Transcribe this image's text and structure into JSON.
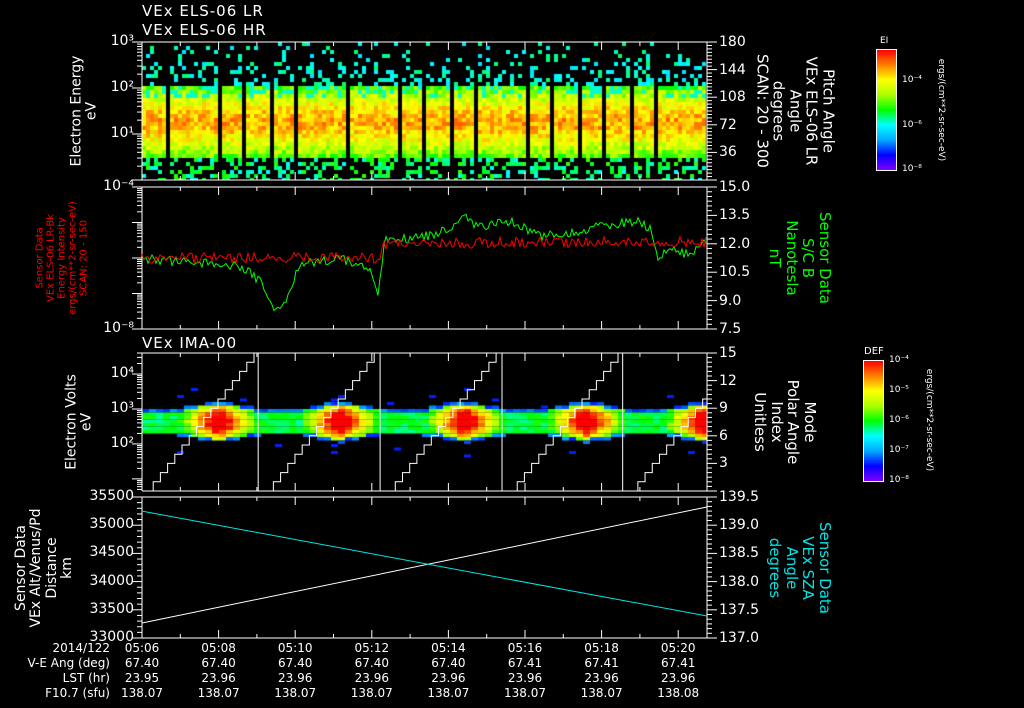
{
  "titles": {
    "els_lr": "VEx ELS-06 LR",
    "els_hr": "VEx ELS-06 HR",
    "ima": "VEx IMA-00"
  },
  "panels": [
    {
      "left_label": [
        "Electron Energy",
        "eV"
      ],
      "left_axis": {
        "scale": "log",
        "range": [
          1,
          1000
        ],
        "ticks": [
          {
            "label": "10³",
            "value": 1000
          },
          {
            "label": "10²",
            "value": 100
          },
          {
            "label": "10¹",
            "value": 10
          }
        ]
      },
      "right_label": [
        "Pitch Angle",
        "VEx ELS-06 LR",
        "Angle",
        "degrees",
        "SCAN: 20 - 300"
      ],
      "right_axis": {
        "scale": "linear",
        "range": [
          0,
          180
        ],
        "ticks": [
          {
            "label": "180",
            "value": 180
          },
          {
            "label": "144",
            "value": 144
          },
          {
            "label": "108",
            "value": 108
          },
          {
            "label": "72",
            "value": 72
          },
          {
            "label": "36",
            "value": 36
          }
        ]
      },
      "label_color": "#ffffff"
    },
    {
      "left_label": [
        "Sensor Data",
        "VEx ELS-06 LR-Bk",
        "Energy Intensity",
        "ergs/(cm**2-sr-sec-eV)",
        "SCAN: 20 - 150"
      ],
      "left_label_color": "#ff0000",
      "left_axis": {
        "scale": "log",
        "range": [
          1e-08,
          0.0001
        ],
        "ticks": [
          {
            "label": "10⁻⁴",
            "value": 0.0001
          },
          {
            "label": "10⁻⁸",
            "value": 1e-08
          }
        ]
      },
      "right_label": [
        "Sensor Data",
        "S/C B",
        "Nanotesla",
        "nT"
      ],
      "right_label_color": "#00ff00",
      "right_axis": {
        "scale": "linear",
        "range": [
          7.5,
          15.0
        ],
        "ticks": [
          {
            "label": "15.0",
            "value": 15
          },
          {
            "label": "13.5",
            "value": 13.5
          },
          {
            "label": "12.0",
            "value": 12
          },
          {
            "label": "10.5",
            "value": 10.5
          },
          {
            "label": "9.0",
            "value": 9
          },
          {
            "label": "7.5",
            "value": 7.5
          }
        ]
      }
    },
    {
      "left_label": [
        "Electron Volts",
        "eV"
      ],
      "left_axis": {
        "scale": "log",
        "range": [
          4.5,
          40000
        ],
        "ticks": [
          {
            "label": "10⁴",
            "value": 10000
          },
          {
            "label": "10³",
            "value": 1000
          },
          {
            "label": "10²",
            "value": 100
          }
        ]
      },
      "right_label": [
        "Mode",
        "Polar Angle",
        "Index",
        "Unitless"
      ],
      "right_axis": {
        "scale": "linear",
        "range": [
          0,
          15
        ],
        "ticks": [
          {
            "label": "15",
            "value": 15
          },
          {
            "label": "12",
            "value": 12
          },
          {
            "label": "9",
            "value": 9
          },
          {
            "label": "6",
            "value": 6
          },
          {
            "label": "3",
            "value": 3
          }
        ]
      }
    },
    {
      "left_label": [
        "Sensor Data",
        "VEx Alt/Venus/Pd",
        "Distance",
        "km"
      ],
      "left_axis": {
        "scale": "linear",
        "range": [
          33000,
          35500
        ],
        "ticks": [
          {
            "label": "35500",
            "value": 35500
          },
          {
            "label": "35000",
            "value": 35000
          },
          {
            "label": "34500",
            "value": 34500
          },
          {
            "label": "34000",
            "value": 34000
          },
          {
            "label": "33500",
            "value": 33500
          },
          {
            "label": "33000",
            "value": 33000
          }
        ]
      },
      "right_label": [
        "Sensor Data",
        "VEx SZA",
        "Angle",
        "degrees"
      ],
      "right_label_color": "#00e5e5",
      "right_axis": {
        "scale": "linear",
        "range": [
          137.0,
          139.5
        ],
        "ticks": [
          {
            "label": "139.5",
            "value": 139.5
          },
          {
            "label": "139.0",
            "value": 139
          },
          {
            "label": "138.5",
            "value": 138.5
          },
          {
            "label": "138.0",
            "value": 138
          },
          {
            "label": "137.5",
            "value": 137.5
          },
          {
            "label": "137.0",
            "value": 137
          }
        ]
      }
    }
  ],
  "colorbars": [
    {
      "title": "EI",
      "units": "ergs/(cm**2-sr-sec-eV)",
      "ticks": [
        "10⁻⁴",
        "10⁻⁶",
        "10⁻⁸"
      ]
    },
    {
      "title": "DEF",
      "units": "ergs/(cm**2-sr-sec-eV)",
      "ticks": [
        "10⁻⁴",
        "10⁻⁵",
        "10⁻⁶",
        "10⁻⁷",
        "10⁻⁸"
      ]
    }
  ],
  "colormap": [
    "#7f00ff",
    "#0000ff",
    "#00aaff",
    "#00ffff",
    "#00ff00",
    "#aaff00",
    "#ffff00",
    "#ff8000",
    "#ff0000"
  ],
  "time_axis": {
    "date": "2014/122",
    "ticks": [
      "05:06",
      "05:08",
      "05:10",
      "05:12",
      "05:14",
      "05:16",
      "05:18",
      "05:20"
    ],
    "rows": [
      {
        "label": "V-E Ang (deg)",
        "values": [
          "67.40",
          "67.40",
          "67.40",
          "67.40",
          "67.40",
          "67.41",
          "67.41",
          "67.41"
        ]
      },
      {
        "label": "LST (hr)",
        "values": [
          "23.95",
          "23.96",
          "23.96",
          "23.96",
          "23.96",
          "23.96",
          "23.96",
          "23.96"
        ]
      },
      {
        "label": "F10.7 (sfu)",
        "values": [
          "138.07",
          "138.07",
          "138.07",
          "138.07",
          "138.07",
          "138.07",
          "138.07",
          "138.08"
        ]
      }
    ]
  },
  "chart_data": [
    {
      "type": "heatmap",
      "title": "VEx ELS-06 LR / VEx ELS-06 HR",
      "xrange": [
        "05:06",
        "05:20:45"
      ],
      "ylabel": "Electron Energy eV",
      "ylim": [
        1,
        1000
      ],
      "yscale": "log",
      "peak_energy_eV": 20,
      "colorbar": "EI"
    },
    {
      "type": "line",
      "xrange": [
        "05:06",
        "05:20:45"
      ],
      "series": [
        {
          "name": "S/C B",
          "axis": "right",
          "color": "#00ff00",
          "points": [
            [
              "05:06:00",
              11.2
            ],
            [
              "05:07:31",
              11.0
            ],
            [
              "05:08:34",
              10.8
            ],
            [
              "05:09:08",
              10.0
            ],
            [
              "05:09:28",
              8.5
            ],
            [
              "05:09:44",
              9.0
            ],
            [
              "05:10:08",
              11.0
            ],
            [
              "05:11:10",
              11.2
            ],
            [
              "05:11:57",
              10.8
            ],
            [
              "05:12:10",
              9.2
            ],
            [
              "05:12:21",
              12.2
            ],
            [
              "05:13:15",
              12.3
            ],
            [
              "05:14:03",
              12.8
            ],
            [
              "05:14:18",
              13.5
            ],
            [
              "05:14:50",
              12.9
            ],
            [
              "05:15:36",
              13.2
            ],
            [
              "05:16:24",
              12.4
            ],
            [
              "05:16:55",
              12.5
            ],
            [
              "05:17:57",
              12.9
            ],
            [
              "05:19:00",
              13.2
            ],
            [
              "05:19:16",
              12.8
            ],
            [
              "05:19:27",
              11.2
            ],
            [
              "05:19:47",
              11.8
            ],
            [
              "05:20:18",
              11.4
            ],
            [
              "05:20:45",
              12.2
            ]
          ]
        },
        {
          "name": "VEx ELS-06 LR-Bk",
          "axis": "left",
          "color": "#ff0000",
          "points": [
            [
              "05:06:00",
              1e-06
            ],
            [
              "05:09:30",
              1e-06
            ],
            [
              "05:12:10",
              1e-06
            ],
            [
              "05:12:21",
              2.5e-06
            ],
            [
              "05:16:00",
              2.8e-06
            ],
            [
              "05:20:45",
              2.8e-06
            ]
          ]
        }
      ]
    },
    {
      "type": "heatmap",
      "title": "VEx IMA-00",
      "xrange": [
        "05:06",
        "05:20:45"
      ],
      "ylabel": "Electron Volts eV",
      "ylim": [
        4.5,
        40000
      ],
      "yscale": "log",
      "peak_times": [
        "05:08:00",
        "05:11:10",
        "05:14:25",
        "05:17:35",
        "05:20:40"
      ],
      "peak_energy_eV": 500,
      "colorbar": "DEF",
      "overlay": {
        "name": "Mode Polar Angle Index",
        "color": "#ffffff",
        "range": [
          0,
          15
        ],
        "reset_times": [
          "05:09:02",
          "05:12:13",
          "05:15:24",
          "05:18:33"
        ]
      }
    },
    {
      "type": "line",
      "xrange": [
        "05:06",
        "05:20:45"
      ],
      "series": [
        {
          "name": "VEx Alt/Venus/Pd",
          "axis": "left",
          "color": "#ffffff",
          "points": [
            [
              "05:06:00",
              33266
            ],
            [
              "05:20:45",
              35323
            ]
          ]
        },
        {
          "name": "VEx SZA",
          "axis": "right",
          "color": "#00e5e5",
          "points": [
            [
              "05:06:00",
              139.25
            ],
            [
              "05:20:45",
              137.39
            ]
          ]
        }
      ]
    }
  ]
}
